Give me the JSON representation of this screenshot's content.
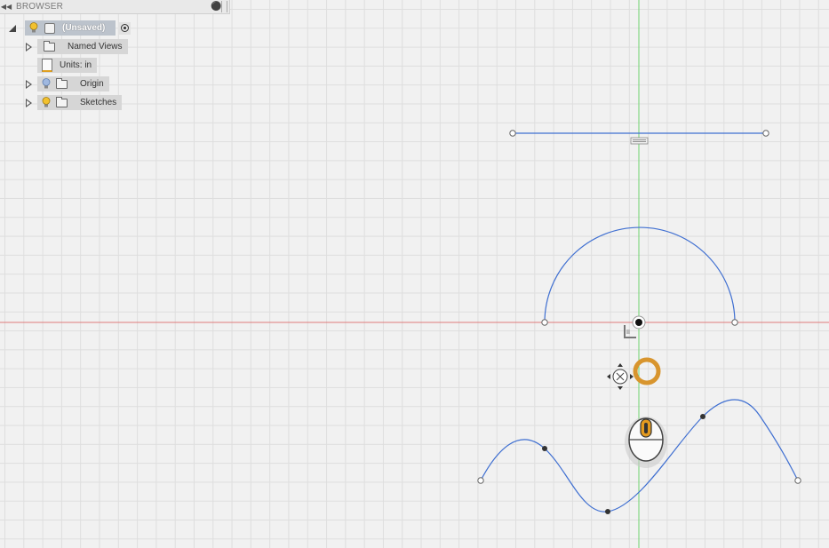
{
  "browser": {
    "title": "BROWSER",
    "collapse_icon": "double-left-arrow-icon",
    "pin_icon": "pin-icon",
    "root": {
      "label": "(Unsaved)",
      "bulb_color": "#f2c12e"
    },
    "items": [
      {
        "label": "Named Views",
        "icon": "folder-icon"
      },
      {
        "label": "Units: in",
        "icon": "document-icon"
      },
      {
        "label": "Origin",
        "icon": "folder-icon",
        "bulb_color": "#9fb8e0"
      },
      {
        "label": "Sketches",
        "icon": "folder-icon",
        "bulb_color": "#f2c12e"
      }
    ]
  },
  "viewport": {
    "background": "#f1f1f1",
    "grid_color": "#dedede",
    "x_axis_color": "#e07a7a",
    "y_axis_color": "#6fd46f",
    "sketch_color": "#3f6fd1",
    "orbit_ring_color": "#d8952e",
    "mouse_wheel_color": "#e39a1f",
    "sketch_entities": [
      "line",
      "arc",
      "spline"
    ],
    "cursor_icons": [
      "horizontal-constraint-icon",
      "origin-point-icon",
      "orbit-cursor-icon",
      "orbit-ring-icon",
      "mouse-middle-button-icon"
    ]
  }
}
